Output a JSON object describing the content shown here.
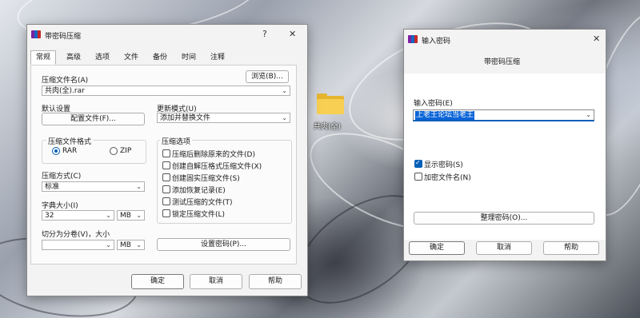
{
  "desktop": {
    "folder_label": "共肉(全)"
  },
  "main_dialog": {
    "title": "带密码压缩",
    "help_glyph": "?",
    "close_glyph": "✕",
    "tabs": [
      "常规",
      "高级",
      "选项",
      "文件",
      "备份",
      "时间",
      "注释"
    ],
    "archive_name_label": "压缩文件名(A)",
    "archive_name_value": "共肉(全).rar",
    "browse_button": "浏览(B)...",
    "default_settings_label": "默认设置",
    "profiles_button": "配置文件(F)...",
    "update_mode_label": "更新模式(U)",
    "update_mode_value": "添加并替换文件",
    "format_group_label": "压缩文件格式",
    "format_options": [
      "RAR",
      "ZIP"
    ],
    "format_selected": "RAR",
    "method_label": "压缩方式(C)",
    "method_value": "标准",
    "dict_label": "字典大小(I)",
    "dict_value": "32",
    "dict_unit": "MB",
    "split_label": "切分为分卷(V)，大小",
    "split_value": "",
    "split_unit": "MB",
    "options_group_label": "压缩选项",
    "options": [
      {
        "label": "压缩后删除原来的文件(D)",
        "checked": false
      },
      {
        "label": "创建自解压格式压缩文件(X)",
        "checked": false
      },
      {
        "label": "创建固实压缩文件(S)",
        "checked": false
      },
      {
        "label": "添加恢复记录(E)",
        "checked": false
      },
      {
        "label": "测试压缩的文件(T)",
        "checked": false
      },
      {
        "label": "锁定压缩文件(L)",
        "checked": false
      }
    ],
    "set_password_button": "设置密码(P)...",
    "ok_button": "确定",
    "cancel_button": "取消",
    "help_button": "帮助"
  },
  "password_dialog": {
    "title": "输入密码",
    "close_glyph": "✕",
    "heading": "带密码压缩",
    "input_label": "输入密码(E)",
    "password_value": "上老王论坛当老王",
    "show_password_label": "显示密码(S)",
    "show_password_checked": true,
    "encrypt_names_label": "加密文件名(N)",
    "encrypt_names_checked": false,
    "organize_button": "整理密码(O)...",
    "ok_button": "确定",
    "cancel_button": "取消",
    "help_button": "帮助"
  },
  "colors": {
    "accent": "#005fb8",
    "selection": "#0a64d8",
    "folder": "#f8cf52"
  }
}
